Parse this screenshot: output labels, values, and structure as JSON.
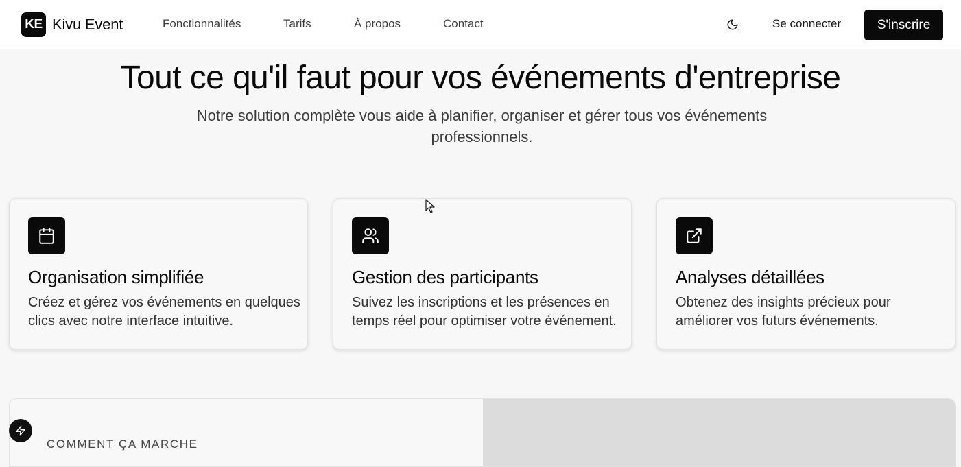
{
  "navbar": {
    "logo_mark": "KE",
    "brand": "Kivu Event",
    "links": [
      {
        "label": "Fonctionnalités"
      },
      {
        "label": "Tarifs"
      },
      {
        "label": "À propos"
      },
      {
        "label": "Contact"
      }
    ],
    "theme_icon": "moon-icon",
    "login_label": "Se connecter",
    "signup_label": "S'inscrire"
  },
  "hero": {
    "title": "Tout ce qu'il faut pour vos événements d'entreprise",
    "subtitle": "Notre solution complète vous aide à planifier, organiser et gérer tous vos événements professionnels."
  },
  "features": [
    {
      "icon": "calendar-icon",
      "title": "Organisation simplifiée",
      "text": "Créez et gérez vos événements en quelques clics avec notre interface intuitive."
    },
    {
      "icon": "users-icon",
      "title": "Gestion des participants",
      "text": "Suivez les inscriptions et les présences en temps réel pour optimiser votre événement."
    },
    {
      "icon": "external-link-icon",
      "title": "Analyses détaillées",
      "text": "Obtenez des insights précieux pour améliorer vos futurs événements."
    }
  ],
  "how_it_works": {
    "eyebrow": "COMMENT ÇA MARCHE"
  },
  "fab_icon": "bolt-icon",
  "colors": {
    "primary": "#0a0a0a",
    "background": "#f7f7f7",
    "card": "#f8f8f8",
    "text_muted": "#3b3b3b"
  }
}
